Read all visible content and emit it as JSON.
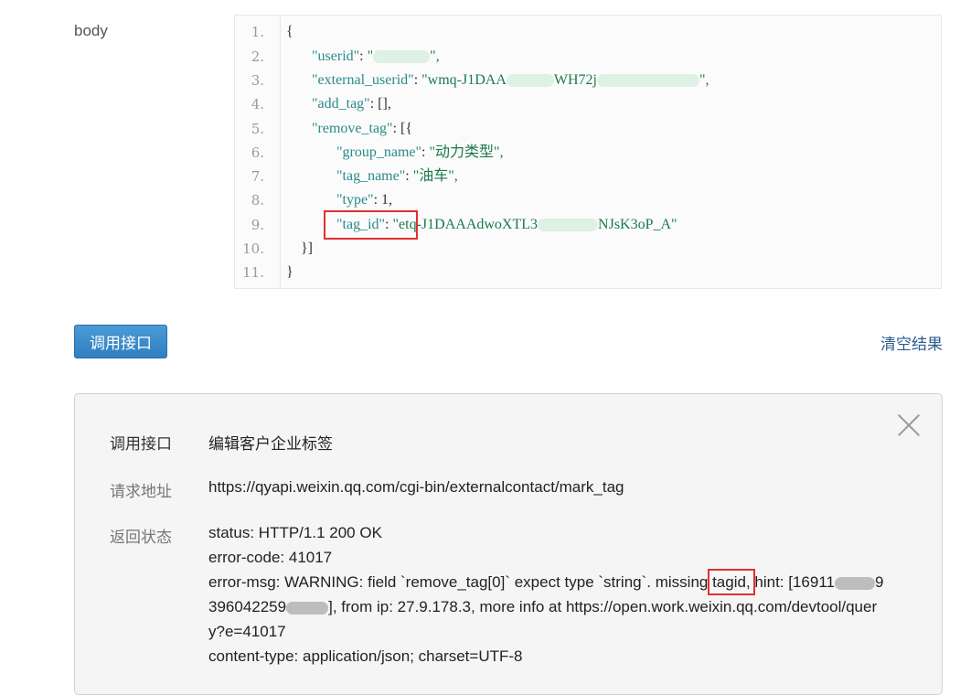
{
  "request": {
    "label": "body",
    "line_numbers": [
      "1.",
      "2.",
      "3.",
      "4.",
      "5.",
      "6.",
      "7.",
      "8.",
      "9.",
      "10.",
      "11."
    ],
    "code": {
      "open_brace": "{",
      "userid_key": "\"userid\"",
      "userid_val_start": "\"",
      "userid_val_end": "\",",
      "ext_key": "\"external_userid\"",
      "ext_val_a": "\"wmq-J1DAA",
      "ext_val_b": "WH72j",
      "ext_val_end": "\",",
      "add_tag_key": "\"add_tag\"",
      "add_tag_val": ": [],",
      "remove_tag_key": "\"remove_tag\"",
      "remove_tag_val": ": [{",
      "group_name_key": "\"group_name\"",
      "group_name_val": "\"动力类型\",",
      "tag_name_key": "\"tag_name\"",
      "tag_name_val": "\"油车\",",
      "type_key": "\"type\"",
      "type_val": ": 1,",
      "tag_id_key": "\"tag_id\"",
      "tag_id_val_a": "\"etq-J1DAAAdwoXTL3",
      "tag_id_val_b": "NJsK3oP_A\"",
      "close_arr": "}]",
      "close_brace": "}",
      "colon": ": "
    }
  },
  "actions": {
    "call_button": "调用接口",
    "clear_link": "清空结果"
  },
  "result": {
    "api_label": "调用接口",
    "api_value": "编辑客户企业标签",
    "url_label": "请求地址",
    "url_value": "https://qyapi.weixin.qq.com/cgi-bin/externalcontact/mark_tag",
    "status_label": "返回状态",
    "status_line": "status: HTTP/1.1 200 OK",
    "errcode_line": "error-code: 41017",
    "errmsg_a": "error-msg: WARNING: field `remove_tag[0]` expect type `string`. missing ",
    "errmsg_tagid": "tagid,",
    "errmsg_b": " hint: [16911",
    "errmsg_b2": "9",
    "errmsg_c": "396042259",
    "errmsg_d": "], from ip: 27.9.178.3, more info at https://open.work.weixin.qq.com/devtool/quer",
    "errmsg_e": "y?e=41017",
    "ctype_line": "content-type: application/json; charset=UTF-8"
  },
  "colors": {
    "button": "#2f7fc1",
    "highlight_border": "#e03030",
    "json_key": "#2a8a8a",
    "json_string": "#1a7a4a"
  }
}
